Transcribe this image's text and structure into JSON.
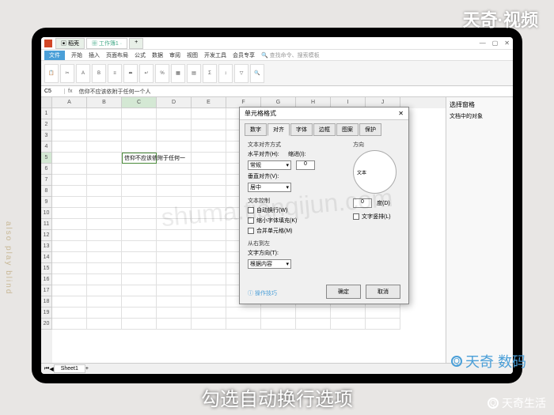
{
  "watermarks": {
    "top": "天奇·视频",
    "middle": "shuma.tianqijun.com",
    "br1": "天奇 数码",
    "br2": "天奇生活"
  },
  "caption": "勾选自动换行选项",
  "app": {
    "doc_tab1": "稻壳",
    "doc_tab2": "工作簿1",
    "menu": {
      "file": "文件",
      "home": "开始",
      "insert": "插入",
      "layout": "页面布局",
      "formula": "公式",
      "data": "数据",
      "review": "审阅",
      "view": "视图",
      "dev": "开发工具",
      "team": "会员专享",
      "search": "查找命令、搜索模板"
    },
    "formula": {
      "cell": "C5",
      "content": "信仰不应该依附于任何一个人"
    },
    "cell_text": "信仰不应该依附于任何一",
    "columns": [
      "A",
      "B",
      "C",
      "D",
      "E",
      "F",
      "G",
      "H",
      "I",
      "J"
    ],
    "rows": [
      1,
      2,
      3,
      4,
      5,
      6,
      7,
      8,
      9,
      10,
      11,
      12,
      13,
      14,
      15,
      16,
      17,
      18,
      19,
      20
    ],
    "sheet_tab": "Sheet1",
    "task_pane": {
      "title": "选择窗格",
      "sub": "文档中的对象"
    }
  },
  "dialog": {
    "title": "单元格格式",
    "tabs": [
      "数字",
      "对齐",
      "字体",
      "边框",
      "图案",
      "保护"
    ],
    "text_align_label": "文本对齐方式",
    "horizontal_label": "水平对齐(H):",
    "horizontal_value": "常规",
    "indent_label": "缩进(I):",
    "vertical_label": "垂直对齐(V):",
    "vertical_value": "居中",
    "text_control_label": "文本控制",
    "wrap": "自动换行(W)",
    "shrink": "缩小字体填充(K)",
    "merge": "合并单元格(M)",
    "rtl_label": "从右到左",
    "direction_label": "文字方向(T):",
    "direction_value": "根据内容",
    "orientation_label": "方向",
    "orientation_text": "文本",
    "degree_label": "度(D)",
    "degree_value": "0",
    "stack_label": "文字竖排(L)",
    "help_link": "操作技巧",
    "ok": "确定",
    "cancel": "取消"
  }
}
